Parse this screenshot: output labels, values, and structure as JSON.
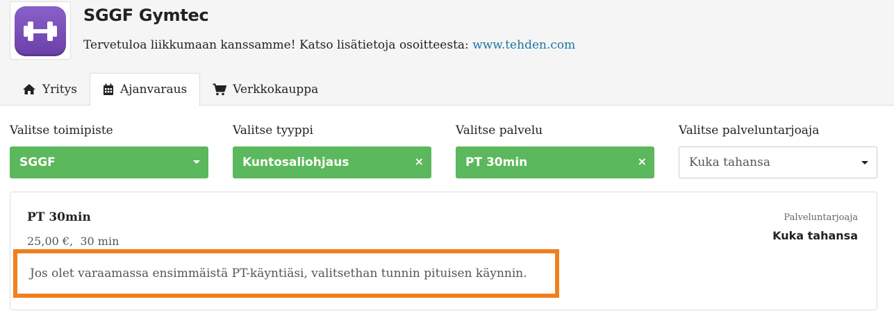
{
  "company": {
    "name": "SGGF Gymtec",
    "welcome_text": "Tervetuloa liikkumaan kanssamme! Katso lisätietoja osoitteesta: ",
    "website": "www.tehden.com",
    "logo_icon": "dumbbell-icon",
    "logo_color": "#7a4fb9"
  },
  "tabs": [
    {
      "label": "Yritys",
      "icon": "home-icon",
      "active": false
    },
    {
      "label": "Ajanvaraus",
      "icon": "calendar-icon",
      "active": true
    },
    {
      "label": "Verkkokauppa",
      "icon": "shopping-cart-icon",
      "active": false
    }
  ],
  "filters": {
    "location": {
      "label": "Valitse toimipiste",
      "value": "SGGF"
    },
    "type": {
      "label": "Valitse tyyppi",
      "value": "Kuntosaliohjaus",
      "clear": "×"
    },
    "service": {
      "label": "Valitse palvelu",
      "value": "PT 30min",
      "clear": "×"
    },
    "provider": {
      "label": "Valitse palveluntarjoaja",
      "value": "Kuka tahansa"
    }
  },
  "service_card": {
    "name": "PT 30min",
    "price_duration": "25,00 €,  30 min",
    "provider_label": "Palveluntarjoaja",
    "provider_value": "Kuka tahansa",
    "notice": "Jos olet varaamassa ensimmäistä PT-käyntiäsi, valitsethan tunnin pituisen käynnin."
  },
  "colors": {
    "selected_green": "#5cb85c",
    "link_blue": "#1f74a5",
    "highlight_orange": "#f07f1e"
  }
}
